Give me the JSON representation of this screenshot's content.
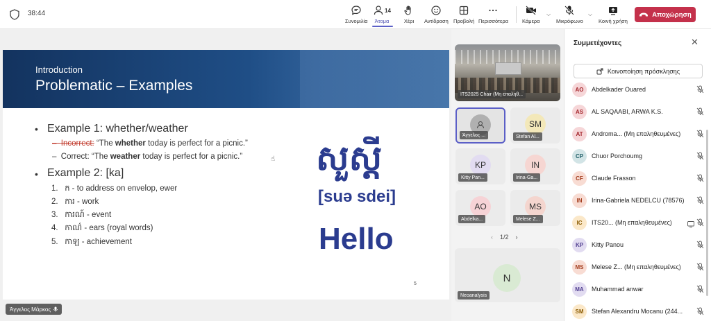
{
  "meeting": {
    "timer": "38:44"
  },
  "toolbar": {
    "chat": "Συνομιλία",
    "people": "Άτομα",
    "people_count": "14",
    "raise": "Χέρι",
    "react": "Αντίδραση",
    "view": "Προβολή",
    "more": "Περισσότερα",
    "camera": "Κάμερα",
    "mic": "Μικρόφωνο",
    "share": "Κοινή χρήση",
    "leave": "Αποχώρηση",
    "accent": "#5b5fc7",
    "leave_color": "#c4314b"
  },
  "slide": {
    "intro": "Introduction",
    "title": "Problematic – Examples",
    "ex1": "Example 1: whether/weather",
    "incorrect_label": "Incorrect:",
    "incorrect_pre": "“The ",
    "incorrect_bold": "whether",
    "incorrect_post": " today is perfect for a picnic.”",
    "correct_pre": "Correct: “The ",
    "correct_bold": "weather",
    "correct_post": " today is perfect for a picnic.”",
    "ex2": "Example 2: [ka]",
    "items": [
      {
        "num": "1.",
        "text": "ក - to address on envelop, ewer"
      },
      {
        "num": "2.",
        "text": "ការ - work"
      },
      {
        "num": "3.",
        "text": "ការណ៍ - event"
      },
      {
        "num": "4.",
        "text": "កាណ៌ - ears (royal words)"
      },
      {
        "num": "5.",
        "text": "កាឡ - achievement"
      }
    ],
    "khmer": "សួស្តី",
    "phonetic": "[suə sdei]",
    "hello": "Hello",
    "page": "5",
    "presenter": "Άγγελος Μάρκος",
    "text_color": "#2b3c8f"
  },
  "grid": {
    "room_label": "ITS2025 Chair (Μη επαληθ...",
    "tiles": [
      {
        "initials": "",
        "name": "Άγγελος ...",
        "color": "#b0b0b0"
      },
      {
        "initials": "SM",
        "name": "Stefan Al...",
        "color": "#f3e8b9"
      },
      {
        "initials": "KP",
        "name": "Kitty Pan...",
        "color": "#e2dcf1"
      },
      {
        "initials": "IN",
        "name": "Irina-Ga...",
        "color": "#f6d6d2"
      },
      {
        "initials": "AO",
        "name": "Abdelka...",
        "color": "#f6d3d6"
      },
      {
        "initials": "MS",
        "name": "Melese Z...",
        "color": "#f4d5ce"
      }
    ],
    "pager": "1/2",
    "big_tile": {
      "initials": "N",
      "name": "Neoanalysis",
      "color": "#d9ead3"
    }
  },
  "panel": {
    "title": "Συμμετέχοντες",
    "invite": "Κοινοποίηση πρόσκλησης",
    "participants": [
      {
        "initials": "AO",
        "name": "Abdelkader Ouared",
        "bg": "#f6d6d8",
        "fg": "#a4262c"
      },
      {
        "initials": "AS",
        "name": "AL SAQAABI, ARWA K.S.",
        "bg": "#f6d6d8",
        "fg": "#a4262c"
      },
      {
        "initials": "AT",
        "name": "Androma... (Μη επαληθευμένες)",
        "bg": "#f6d6d8",
        "fg": "#a4262c"
      },
      {
        "initials": "CP",
        "name": "Chuor Porchoumg",
        "bg": "#d2e4e6",
        "fg": "#1e5e67"
      },
      {
        "initials": "CF",
        "name": "Claude Frasson",
        "bg": "#f8dcd3",
        "fg": "#a33d1e"
      },
      {
        "initials": "IN",
        "name": "Irina-Gabriela NEDELCU (78576)",
        "bg": "#f8dcd3",
        "fg": "#a33d1e"
      },
      {
        "initials": "IC",
        "name": "ITS20... (Μη επαληθευμένες)",
        "bg": "#fbe8c9",
        "fg": "#8a5a00"
      },
      {
        "initials": "KP",
        "name": "Kitty Panou",
        "bg": "#e2dcf1",
        "fg": "#4f3d8f"
      },
      {
        "initials": "MS",
        "name": "Melese Z... (Μη επαληθευμένες)",
        "bg": "#f8dcd3",
        "fg": "#a33d1e"
      },
      {
        "initials": "MA",
        "name": "Muhammad anwar",
        "bg": "#e2dcf1",
        "fg": "#4f3d8f"
      },
      {
        "initials": "SM",
        "name": "Stefan Alexandru Mocanu (244...",
        "bg": "#fbe8c9",
        "fg": "#8a5a00"
      }
    ]
  }
}
